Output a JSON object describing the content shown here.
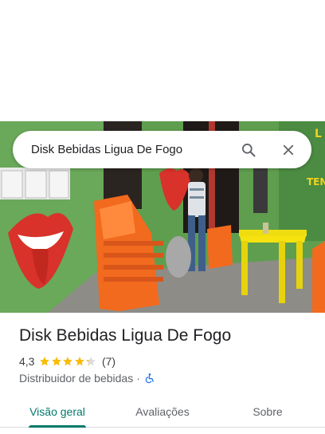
{
  "search": {
    "query": "Disk Bebidas Ligua De Fogo",
    "search_icon": "search-icon",
    "close_icon": "close-icon"
  },
  "photo": {
    "description_icon": "storefront-photo"
  },
  "place": {
    "name": "Disk Bebidas Ligua De Fogo",
    "rating": "4,3",
    "rating_value": 4.3,
    "review_count": "(7)",
    "category": "Distribuidor de bebidas",
    "separator": "·",
    "accessibility_icon": "wheelchair-icon"
  },
  "tabs": [
    {
      "label": "Visão geral",
      "active": true
    },
    {
      "label": "Avaliações",
      "active": false
    },
    {
      "label": "Sobre",
      "active": false
    }
  ],
  "colors": {
    "accent": "#00796b",
    "star": "#fbbc04",
    "star_empty": "#dadce0",
    "accessibility": "#1a73e8"
  }
}
